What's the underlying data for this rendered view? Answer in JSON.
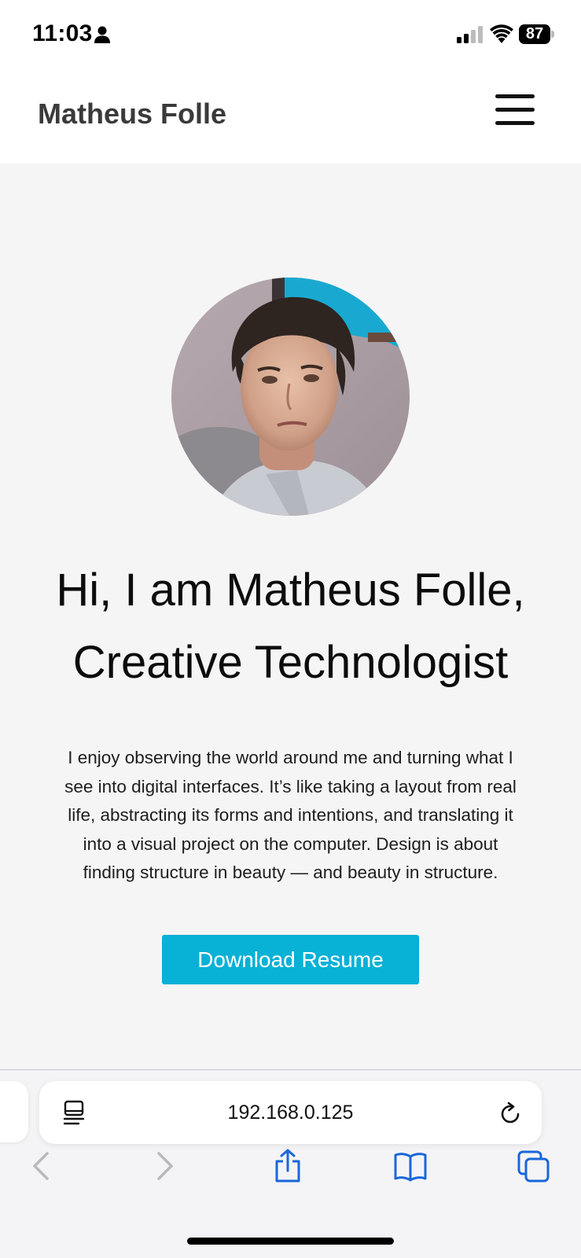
{
  "status_bar": {
    "time": "11:03",
    "battery": "87",
    "icons": [
      "person-icon",
      "signal-icon",
      "wifi-icon",
      "battery-icon"
    ]
  },
  "header": {
    "site_title": "Matheus Folle",
    "menu_icon": "hamburger-menu-icon"
  },
  "hero": {
    "avatar": "profile-photo",
    "heading_line1": "Hi, I am Matheus Folle,",
    "heading_line2": "Creative Technologist",
    "intro_line1": "I enjoy observing the world around me and turning what I",
    "intro_line2": "see into digital interfaces. It’s like taking a layout from real",
    "intro_line3": "life, abstracting its forms and intentions, and translating it",
    "intro_line4": "into a visual project on the computer. Design is about",
    "intro_line5": "finding structure in beauty — and beauty in structure.",
    "resume_button": "Download Resume",
    "accent_color": "#08b1d6"
  },
  "browser": {
    "url": "192.168.0.125",
    "toolbar_icons": [
      "back-icon",
      "forward-icon",
      "share-icon",
      "bookmarks-icon",
      "tabs-icon"
    ],
    "tint_color": "#1a66d9"
  }
}
